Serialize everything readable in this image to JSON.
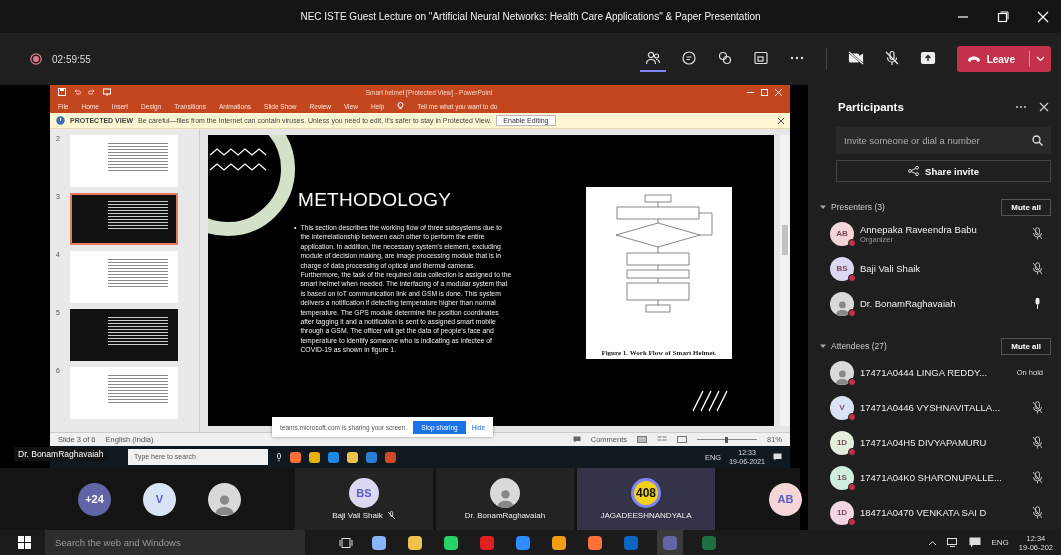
{
  "window": {
    "title": "NEC ISTE Guest Lecture on \"Artificial Neural Networks: Health Care Applications\" & Paper Presentation"
  },
  "meeting_bar": {
    "recording_time": "02:59:55",
    "buttons": [
      {
        "kind": "people",
        "selected": true
      },
      {
        "kind": "chat",
        "selected": false
      },
      {
        "kind": "reactions",
        "selected": false
      },
      {
        "kind": "rooms",
        "selected": false
      },
      {
        "kind": "more",
        "selected": false
      }
    ],
    "controls": [
      {
        "kind": "camera-off"
      },
      {
        "kind": "mic-off"
      },
      {
        "kind": "share"
      }
    ],
    "leave_label": "Leave"
  },
  "shared_screen": {
    "app_title": "Smart helmet [Protected View] - PowerPoint",
    "ribbon_tabs": [
      "File",
      "Home",
      "Insert",
      "Design",
      "Transitions",
      "Animations",
      "Slide Show",
      "Review",
      "View",
      "Help"
    ],
    "tell_me": "Tell me what you want to do",
    "protected_view": {
      "label": "PROTECTED VIEW",
      "message": "Be careful—files from the Internet can contain viruses. Unless you need to edit, it's safer to stay in Protected View.",
      "button": "Enable Editing"
    },
    "thumbnails": [
      {
        "number": "2",
        "kind": "light",
        "selected": false
      },
      {
        "number": "3",
        "kind": "dark",
        "selected": true
      },
      {
        "number": "4",
        "kind": "light",
        "selected": false
      },
      {
        "number": "5",
        "kind": "dark",
        "selected": false
      },
      {
        "number": "6",
        "kind": "light",
        "selected": false
      }
    ],
    "slide": {
      "title": "METHODOLOGY",
      "bullet_mark": "•",
      "body": "This section describes the working flow of three subsystems due to the interrelationship between each other to perform the entire application. In addition, the necessary system's element, excluding module of decision making, are image processing module that is in charge of data processing of optical and thermal cameras. Furthermore, the task of the required data collection is assigned to the smart helmet when needed. The interfacing of a modular system that is based on IoT communication link and GSM is done. This system delivers a notification if detecting temperature higher than normal temperature. The GPS module determine the position coordinates after tagging it and a notification is sent to assigned smart mobile through a GSM. The officer will get the data of people's face and temperature to identify someone who is indicating as infectee of COVID-19 as shown in figure 1.",
      "figure_caption": "Figure 1. Work Flow of Smart Helmet."
    },
    "status_bar": {
      "slide_info": "Slide 3 of 6",
      "language": "English (India)",
      "comments": "Comments",
      "zoom": "81%",
      "zoom_slider": {
        "level": 0.5
      }
    },
    "sharing_notice": {
      "message": "teams.microsoft.com is sharing your screen.",
      "stop_button": "Stop sharing",
      "hide_button": "Hide"
    },
    "taskbar": {
      "search_placeholder": "Type here to search",
      "language": "ENG",
      "time": "12:33",
      "date": "19-06-2021"
    },
    "presenter_label": "Dr. BonamRaghavaiah"
  },
  "gallery": [
    {
      "kind": "bubble",
      "avatar": {
        "kind": "count",
        "text": "+24",
        "color": "#6264a7"
      }
    },
    {
      "kind": "bubble",
      "avatar": {
        "kind": "initials",
        "text": "V",
        "color": "#dae3f5"
      }
    },
    {
      "kind": "bubble",
      "avatar": {
        "kind": "photo"
      }
    },
    {
      "kind": "tile",
      "highlighted": false,
      "muted": true,
      "name": "Baji Vali Shaik",
      "avatar": {
        "kind": "initials",
        "text": "BS",
        "color": "#dcd8f2"
      }
    },
    {
      "kind": "tile",
      "highlighted": false,
      "muted": false,
      "name": "Dr. BonamRaghavaiah",
      "avatar": {
        "kind": "photo"
      }
    },
    {
      "kind": "tile",
      "highlighted": true,
      "muted": false,
      "name": "JAGADEESHNANDYALA",
      "avatar": {
        "kind": "badge",
        "text": "408"
      }
    },
    {
      "kind": "bubble",
      "avatar": {
        "kind": "initials",
        "text": "AB",
        "color": "#f4d6d8"
      }
    }
  ],
  "participants": {
    "title": "Participants",
    "search_placeholder": "Invite someone or dial a number",
    "share_button": "Share invite",
    "sections": [
      {
        "label": "Presenters (3)",
        "expanded": true,
        "mute_all": "Mute all",
        "people": [
          {
            "name": "Annepaka Raveendra Babu",
            "role": "Organizer",
            "muted": true,
            "avatar": {
              "kind": "initials",
              "text": "AB",
              "color": "#f4d6d8"
            }
          },
          {
            "name": "Baji Vali Shaik",
            "muted": true,
            "avatar": {
              "kind": "initials",
              "text": "BS",
              "color": "#dcd8f2"
            }
          },
          {
            "name": "Dr. BonamRaghavaiah",
            "muted": false,
            "avatar": {
              "kind": "photo"
            }
          }
        ]
      },
      {
        "label": "Attendees (27)",
        "expanded": true,
        "mute_all": "Mute all",
        "people": [
          {
            "name": "17471A0444 LINGA REDDY...",
            "status": "On hold",
            "muted": false,
            "avatar": {
              "kind": "photo"
            }
          },
          {
            "name": "17471A0446 VYSHNAVITALLA...",
            "muted": true,
            "avatar": {
              "kind": "initials",
              "text": "V",
              "color": "#dae3f5"
            }
          },
          {
            "name": "17471A04H5 DIVYAPAMURU",
            "muted": true,
            "avatar": {
              "kind": "initials",
              "text": "1D",
              "color": "#e3eedc"
            }
          },
          {
            "name": "17471A04K0 SHARONUPALLE...",
            "muted": true,
            "avatar": {
              "kind": "initials",
              "text": "1S",
              "color": "#cfeede"
            }
          },
          {
            "name": "18471A0470 VENKATA SAI D",
            "muted": true,
            "avatar": {
              "kind": "initials",
              "text": "1D",
              "color": "#f2d6e4"
            }
          }
        ]
      }
    ]
  },
  "windows_taskbar": {
    "search_placeholder": "Search the web and Windows",
    "language": "ENG",
    "time": "12:34",
    "date": "19-06-202"
  }
}
